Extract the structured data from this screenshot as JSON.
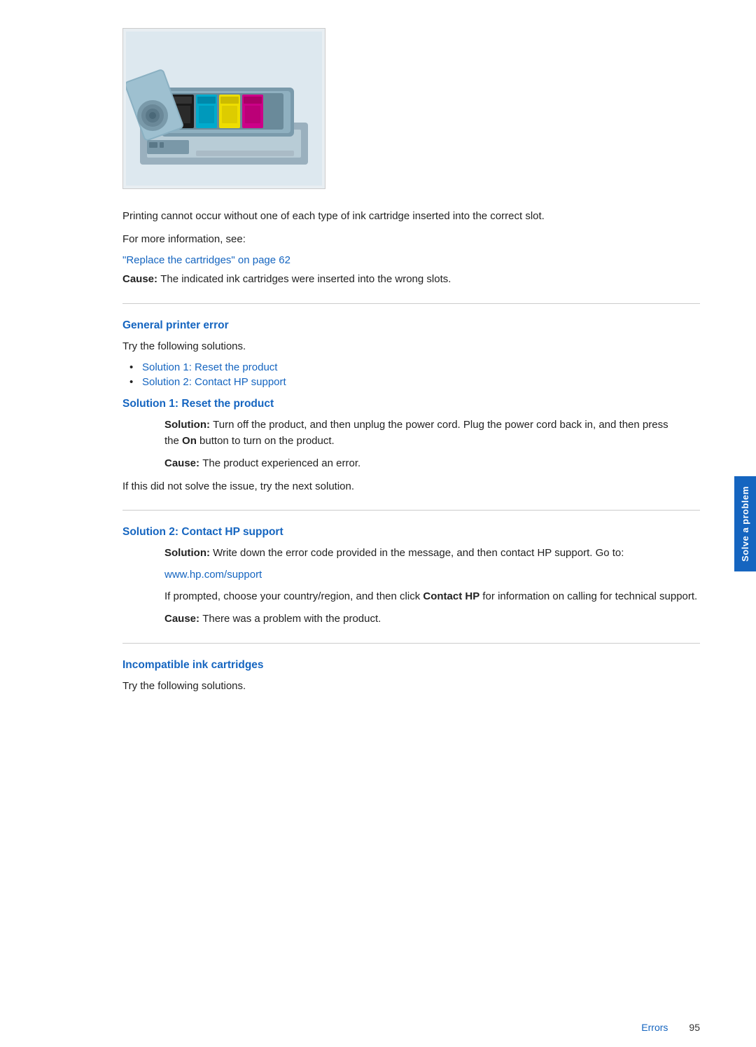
{
  "side_tab": {
    "label": "Solve a problem",
    "bg_color": "#1565c0"
  },
  "printer_image": {
    "alt": "Ink cartridges in printer"
  },
  "intro_section": {
    "body1": "Printing cannot occur without one of each type of ink cartridge inserted into the correct slot.",
    "for_more_info": "For more information, see:",
    "link_replace": "\"Replace the cartridges\" on page 62",
    "cause_label": "Cause:",
    "cause_text": "The indicated ink cartridges were inserted into the wrong slots."
  },
  "general_printer_error": {
    "heading": "General printer error",
    "intro": "Try the following solutions.",
    "solutions": [
      {
        "label": "Solution 1: Reset the product"
      },
      {
        "label": "Solution 2: Contact HP support"
      }
    ]
  },
  "solution1": {
    "heading": "Solution 1: Reset the product",
    "solution_label": "Solution:",
    "solution_text": "Turn off the product, and then unplug the power cord. Plug the power cord back in, and then press the",
    "on_bold": "On",
    "solution_text2": "button to turn on the product.",
    "cause_label": "Cause:",
    "cause_text": "The product experienced an error.",
    "next_solution_text": "If this did not solve the issue, try the next solution."
  },
  "solution2": {
    "heading": "Solution 2: Contact HP support",
    "solution_label": "Solution:",
    "solution_text": "Write down the error code provided in the message, and then contact HP support. Go to:",
    "link_url": "www.hp.com/support",
    "followup1": "If prompted, choose your country/region, and then click",
    "contact_hp_bold": "Contact HP",
    "followup2": "for information on calling for technical support.",
    "cause_label": "Cause:",
    "cause_text": "There was a problem with the product."
  },
  "incompatible_cartridges": {
    "heading": "Incompatible ink cartridges",
    "intro": "Try the following solutions."
  },
  "footer": {
    "label": "Errors",
    "page_number": "95"
  }
}
